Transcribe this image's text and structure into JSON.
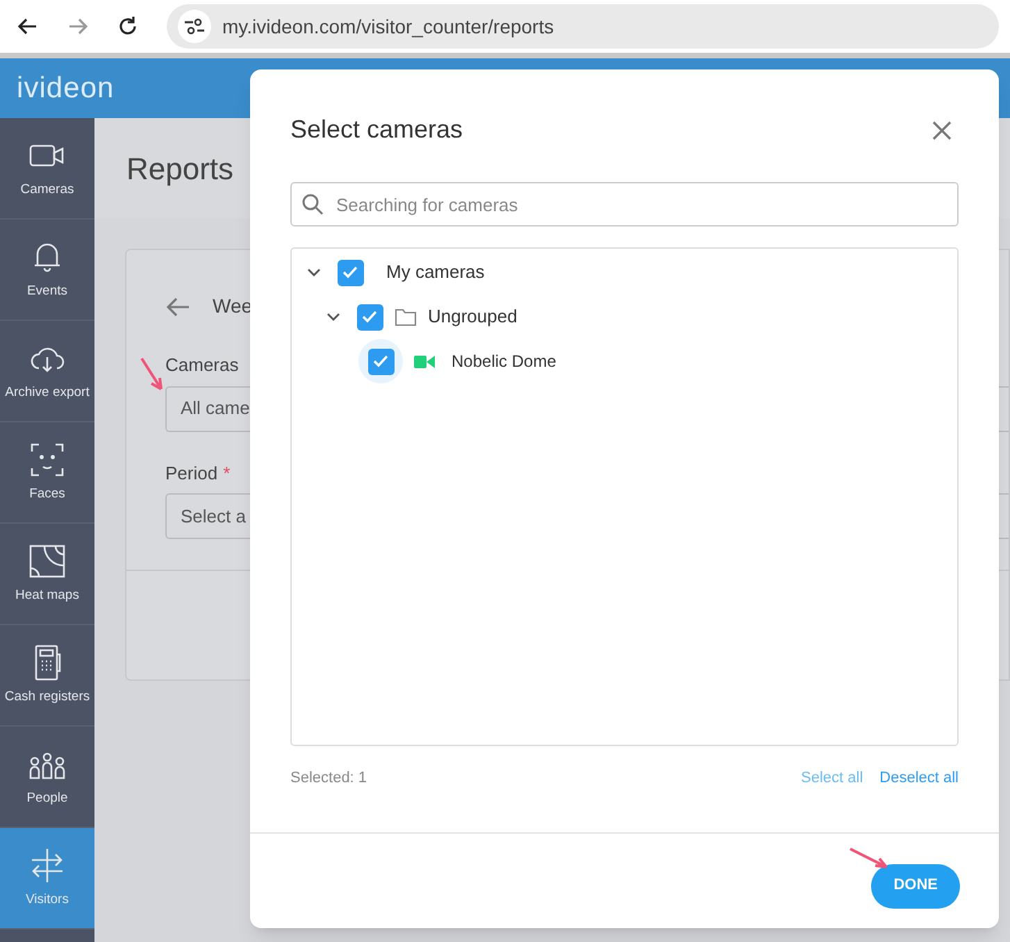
{
  "browser": {
    "url": "my.ivideon.com/visitor_counter/reports"
  },
  "app": {
    "logo": "ivideon"
  },
  "sidebar": {
    "items": [
      {
        "label": "Cameras",
        "selected": false
      },
      {
        "label": "Events",
        "selected": false
      },
      {
        "label": "Archive export",
        "selected": false
      },
      {
        "label": "Faces",
        "selected": false
      },
      {
        "label": "Heat maps",
        "selected": false
      },
      {
        "label": "Cash registers",
        "selected": false
      },
      {
        "label": "People",
        "selected": false
      },
      {
        "label": "Visitors",
        "selected": true
      }
    ]
  },
  "page": {
    "title": "Reports",
    "report_name": "Wee",
    "cameras_label": "Cameras",
    "cameras_value": "All came",
    "period_label": "Period",
    "period_required": "*",
    "period_value": "Select a"
  },
  "dialog": {
    "title": "Select cameras",
    "search": {
      "placeholder": "Searching for cameras"
    },
    "tree": [
      {
        "label": "My cameras",
        "kind": "root",
        "checked": true,
        "expanded": true,
        "children": [
          {
            "label": "Ungrouped",
            "kind": "folder",
            "checked": true,
            "expanded": true,
            "children": [
              {
                "label": "Nobelic Dome",
                "kind": "camera",
                "checked": true
              }
            ]
          }
        ]
      }
    ],
    "selected_count": "Selected: 1",
    "select_all": "Select all",
    "deselect_all": "Deselect all",
    "done": "DONE"
  }
}
